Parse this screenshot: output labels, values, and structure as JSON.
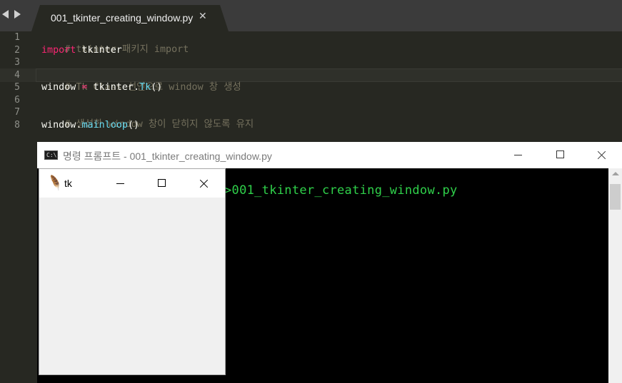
{
  "editor": {
    "tab": {
      "filename": "001_tkinter_creating_window.py",
      "close_glyph": "✕"
    },
    "line_numbers": [
      "1",
      "2",
      "3",
      "4",
      "5",
      "6",
      "7",
      "8"
    ],
    "lines": {
      "l1_comment": "# tkinter 패키지 import",
      "l2_keyword": "import",
      "l2_rest": " tkinter",
      "l4_comment": "# Tk Class 선언으로 window 창 생성",
      "l5_var": "window",
      "l5_op": " = ",
      "l5_mod": "tkinter.",
      "l5_cls": "Tk",
      "l5_paren": "()",
      "l7_comment": "# 생성한 window 창이 닫히지 않도록 유지",
      "l8_obj": "window.",
      "l8_method": "mainloop",
      "l8_paren": "()"
    },
    "colors": {
      "background": "#272822",
      "comment": "#75715e",
      "keyword": "#f92672",
      "class": "#66d9ef",
      "text": "#f8f8f2"
    }
  },
  "cmd_window": {
    "title": "명령 프롬프트 - 001_tkinter_creating_window.py",
    "icon_text": "C:\\.",
    "output": ">001_tkinter_creating_window.py",
    "output_color": "#2fd04a"
  },
  "tk_window": {
    "title": "tk",
    "icon": "feather-icon"
  }
}
